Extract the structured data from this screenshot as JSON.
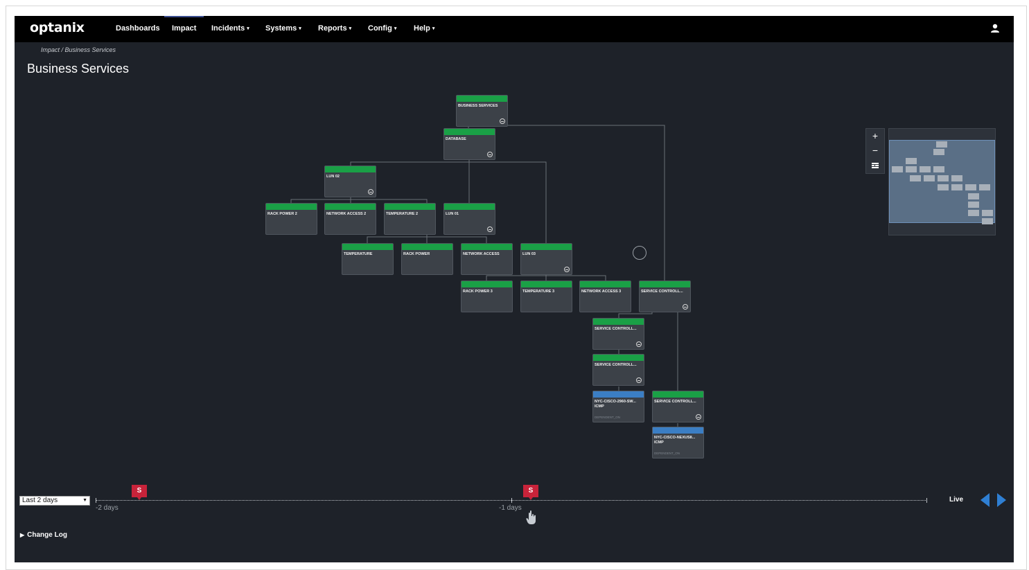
{
  "nav": {
    "brand": "optanix",
    "items": [
      {
        "label": "Dashboards",
        "caret": ""
      },
      {
        "label": "Impact",
        "caret": ""
      },
      {
        "label": "Incidents",
        "caret": "▾"
      },
      {
        "label": "Systems",
        "caret": "▾"
      },
      {
        "label": "Reports",
        "caret": "▾"
      },
      {
        "label": "Config",
        "caret": "▾"
      },
      {
        "label": "Help",
        "caret": "▾"
      }
    ],
    "user_icon": "user-icon"
  },
  "breadcrumb": "Impact / Business Services",
  "page_title": "Business Services",
  "colors": {
    "status_ok": "#1aa046",
    "status_dependent": "#3b7ec4",
    "node_bg": "#3c4148",
    "canvas_bg": "#1e2229",
    "marker": "#c8233a",
    "nav_arrow": "#2f7fd3"
  },
  "nodes": [
    {
      "label": "BUSINESS SERVICES",
      "collapsible": true
    },
    {
      "label": "DATABASE",
      "collapsible": true
    },
    {
      "label": "LUN 02",
      "collapsible": true
    },
    {
      "label": "RACK POWER 2",
      "collapsible": false
    },
    {
      "label": "NETWORK ACCESS 2",
      "collapsible": false
    },
    {
      "label": "TEMPERATURE 2",
      "collapsible": false
    },
    {
      "label": "LUN 01",
      "collapsible": true
    },
    {
      "label": "TEMPERATURE",
      "collapsible": false
    },
    {
      "label": "RACK POWER",
      "collapsible": false
    },
    {
      "label": "NETWORK ACCESS",
      "collapsible": false
    },
    {
      "label": "LUN 03",
      "collapsible": true
    },
    {
      "label": "RACK POWER 3",
      "collapsible": false
    },
    {
      "label": "TEMPERATURE 3",
      "collapsible": false
    },
    {
      "label": "NETWORK ACCESS 3",
      "collapsible": false
    },
    {
      "label": "SERVICE CONTROLL...",
      "collapsible": true
    },
    {
      "label": "SERVICE CONTROLL...",
      "collapsible": true
    },
    {
      "label": "SERVICE CONTROLL...",
      "collapsible": true
    },
    {
      "label": "NYC-CISCO-2960-SW...\nICMP",
      "sub": "DEPENDENT_ON",
      "status": "dependent",
      "collapsible": false
    },
    {
      "label": "SERVICE CONTROLL...",
      "collapsible": true
    },
    {
      "label": "NYC-CISCO-NEXUS8...\nICMP",
      "sub": "DEPENDENT_ON",
      "status": "dependent",
      "collapsible": false
    }
  ],
  "zoom": {
    "in": "+",
    "out": "−",
    "fit_icon": "grid-icon"
  },
  "timeline": {
    "range": "Last 2 days",
    "labels": [
      "-2 days",
      "-1 days"
    ],
    "markers": [
      "S",
      "S"
    ],
    "live": "Live"
  },
  "change_log": "Change Log"
}
